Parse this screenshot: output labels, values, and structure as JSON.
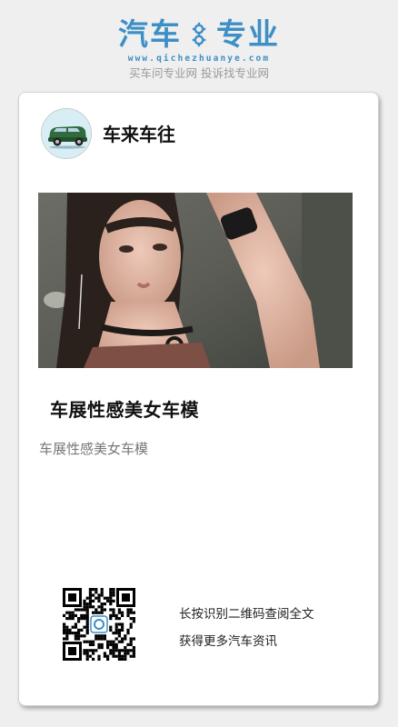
{
  "brand": {
    "logo_left": "汽车",
    "logo_right": "专业",
    "domain": "www.qichezhuanye.com",
    "tagline": "买车问专业网 投诉找专业网",
    "accent": "#3d8fc6"
  },
  "account": {
    "name": "车来车往",
    "avatar_icon": "green-car-icon"
  },
  "article": {
    "title": "车展性感美女车模",
    "summary": "车展性感美女车模",
    "image_icon": "car-model-photo"
  },
  "qr": {
    "line1": "长按识别二维码查阅全文",
    "line2": "获得更多汽车资讯",
    "icon": "qr-code-icon"
  }
}
